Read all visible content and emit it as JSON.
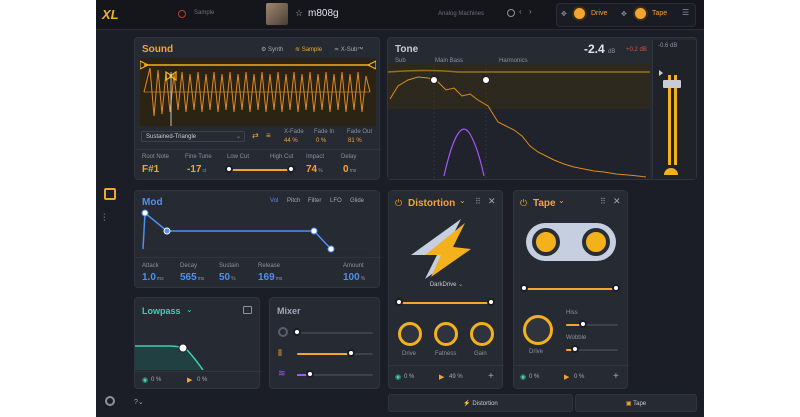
{
  "topbar": {
    "logo": "XL",
    "sample_label": "Sample",
    "preset_name": "m808g",
    "bank": "Analog Machines",
    "drive_label": "Drive",
    "tape_label": "Tape"
  },
  "sound": {
    "title": "Sound",
    "tabs": [
      "Synth",
      "Sample",
      "X-Sub™"
    ],
    "waveform": "Sustained-Triangle",
    "xfade_label": "X-Fade",
    "xfade": "44 %",
    "fadein_label": "Fade In",
    "fadein": "0 %",
    "fadeout_label": "Fade Out",
    "fadeout": "81 %",
    "root_label": "Root Note",
    "root": "F#1",
    "fine_label": "Fine Tune",
    "fine": "-17",
    "fine_unit": "ct",
    "lowcut_label": "Low Cut",
    "highcut_label": "High Cut",
    "impact_label": "Impact",
    "impact": "74",
    "impact_unit": "%",
    "delay_label": "Delay",
    "delay": "0",
    "delay_unit": "ms"
  },
  "tone": {
    "title": "Tone",
    "gain": "-2.4",
    "gain_unit": "dB",
    "gain_delta": "+0.2 dB",
    "bands": [
      "Sub",
      "Main Bass",
      "Harmonics"
    ],
    "meter_label": "-0.6 dB"
  },
  "mod": {
    "title": "Mod",
    "tabs": [
      "Vol",
      "Pitch",
      "Filter",
      "LFO",
      "Glide"
    ],
    "attack_label": "Attack",
    "attack": "1.0",
    "attack_unit": "ms",
    "decay_label": "Decay",
    "decay": "565",
    "decay_unit": "ms",
    "sustain_label": "Sustain",
    "sustain": "50",
    "sustain_unit": "%",
    "release_label": "Release",
    "release": "169",
    "release_unit": "ms",
    "amount_label": "Amount",
    "amount": "100",
    "amount_unit": "%"
  },
  "distortion": {
    "title": "Distortion",
    "preset": "DarkDrive",
    "knobs": [
      "Drive",
      "Fatness",
      "Gain"
    ],
    "bottom_left": "0 %",
    "bottom_right": "49 %"
  },
  "tape": {
    "title": "Tape",
    "hiss_label": "Hiss",
    "wobble_label": "Wobble",
    "drive_label": "Drive",
    "bottom_left": "0 %",
    "bottom_right": "0 %"
  },
  "lowpass": {
    "title": "Lowpass",
    "bottom_left": "0 %",
    "bottom_right": "0 %"
  },
  "mixer": {
    "title": "Mixer"
  },
  "bottom_tabs": [
    "Distortion",
    "Tape"
  ]
}
